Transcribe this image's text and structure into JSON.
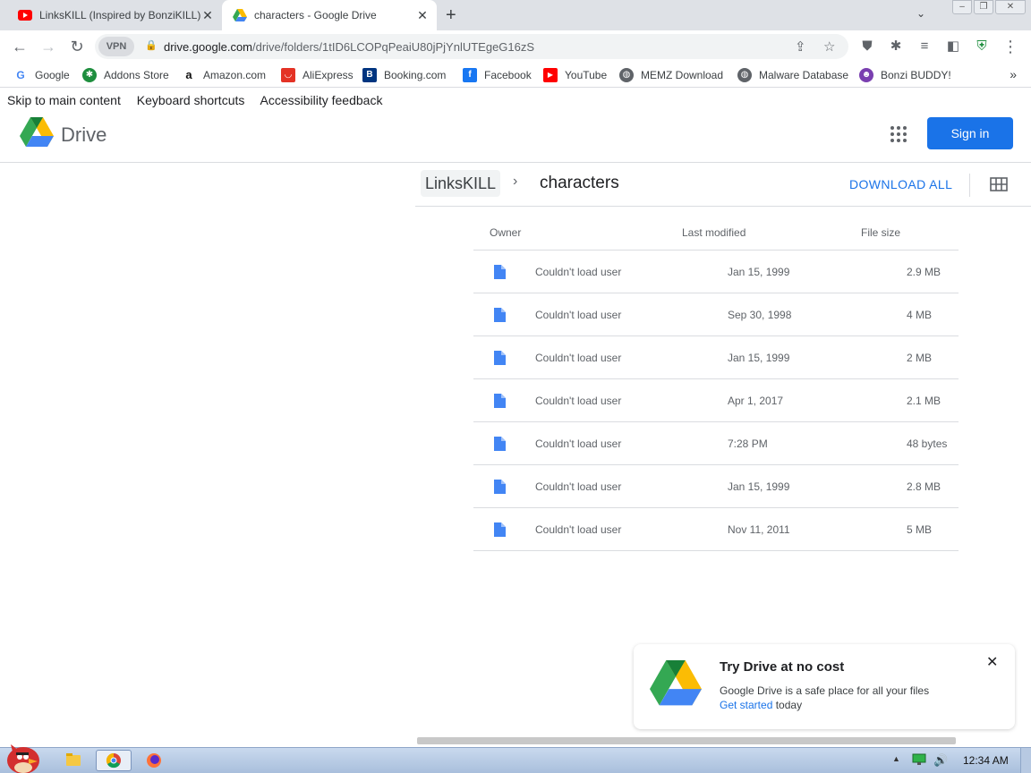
{
  "browser": {
    "tabs": [
      {
        "title": "LinksKILL (Inspired by BonziKILL)",
        "favicon": "youtube-icon",
        "active": false
      },
      {
        "title": "characters - Google Drive",
        "favicon": "google-drive-icon",
        "active": true
      }
    ],
    "url_host": "drive.google.com",
    "url_path": "/drive/folders/1tID6LCOPqPeaiU80jPjYnlUTEgeG16zS",
    "vpn_label": "VPN",
    "bookmarks": [
      {
        "label": "Google",
        "icon": "google-icon"
      },
      {
        "label": "Addons Store",
        "icon": "addons-store-icon"
      },
      {
        "label": "Amazon.com",
        "icon": "amazon-icon"
      },
      {
        "label": "AliExpress",
        "icon": "aliexpress-icon"
      },
      {
        "label": "Booking.com",
        "icon": "booking-icon"
      },
      {
        "label": "Facebook",
        "icon": "facebook-icon"
      },
      {
        "label": "YouTube",
        "icon": "youtube-icon"
      },
      {
        "label": "MEMZ Download",
        "icon": "globe-icon"
      },
      {
        "label": "Malware Database",
        "icon": "globe-icon"
      },
      {
        "label": "Bonzi BUDDY!",
        "icon": "bonzi-icon"
      }
    ],
    "more_bookmarks": "»"
  },
  "skip_links": [
    "Skip to main content",
    "Keyboard shortcuts",
    "Accessibility feedback"
  ],
  "drive": {
    "app_name": "Drive",
    "sign_in": "Sign in",
    "breadcrumb_parent": "LinksKILL",
    "breadcrumb_current": "characters",
    "download_all": "DOWNLOAD ALL",
    "columns": {
      "owner": "Owner",
      "modified": "Last modified",
      "size": "File size"
    },
    "files": [
      {
        "owner": "Couldn't load user",
        "modified": "Jan 15, 1999",
        "size": "2.9 MB"
      },
      {
        "owner": "Couldn't load user",
        "modified": "Sep 30, 1998",
        "size": "4 MB"
      },
      {
        "owner": "Couldn't load user",
        "modified": "Jan 15, 1999",
        "size": "2 MB"
      },
      {
        "owner": "Couldn't load user",
        "modified": "Apr 1, 2017",
        "size": "2.1 MB"
      },
      {
        "owner": "Couldn't load user",
        "modified": "7:28 PM",
        "size": "48 bytes"
      },
      {
        "owner": "Couldn't load user",
        "modified": "Jan 15, 1999",
        "size": "2.8 MB"
      },
      {
        "owner": "Couldn't load user",
        "modified": "Nov 11, 2011",
        "size": "5 MB"
      }
    ]
  },
  "promo": {
    "title": "Try Drive at no cost",
    "text": "Google Drive is a safe place for all your files",
    "link": "Get started",
    "suffix": " today"
  },
  "taskbar": {
    "clock": "12:34 AM"
  },
  "colors": {
    "accent": "#1a73e8",
    "drive_green": "#34a853",
    "drive_yellow": "#fbbc04",
    "drive_blue": "#4285f4"
  }
}
